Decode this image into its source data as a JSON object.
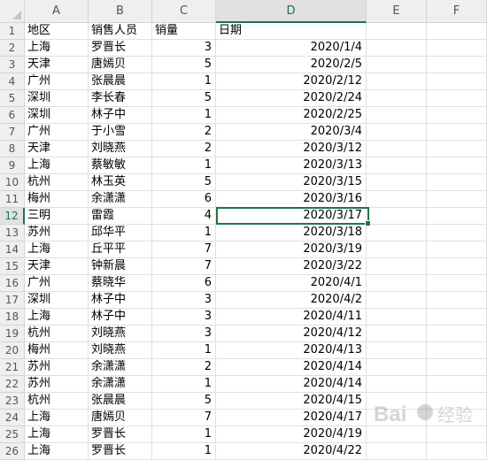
{
  "sheet": {
    "columns": [
      "A",
      "B",
      "C",
      "D",
      "E",
      "F"
    ],
    "selected_column": "D",
    "selected_row": "12",
    "rows": [
      {
        "n": "1",
        "a": "地区",
        "b": "销售人员",
        "c": "销量",
        "d": "日期"
      },
      {
        "n": "2",
        "a": "上海",
        "b": "罗晋长",
        "c": "3",
        "d": "2020/1/4"
      },
      {
        "n": "3",
        "a": "天津",
        "b": "唐嫣贝",
        "c": "5",
        "d": "2020/2/5"
      },
      {
        "n": "4",
        "a": "广州",
        "b": "张晨晨",
        "c": "1",
        "d": "2020/2/12"
      },
      {
        "n": "5",
        "a": "深圳",
        "b": "李长春",
        "c": "5",
        "d": "2020/2/24"
      },
      {
        "n": "6",
        "a": "深圳",
        "b": "林子中",
        "c": "1",
        "d": "2020/2/25"
      },
      {
        "n": "7",
        "a": "广州",
        "b": "于小雪",
        "c": "2",
        "d": "2020/3/4"
      },
      {
        "n": "8",
        "a": "天津",
        "b": "刘晓燕",
        "c": "2",
        "d": "2020/3/12"
      },
      {
        "n": "9",
        "a": "上海",
        "b": "蔡敏敏",
        "c": "1",
        "d": "2020/3/13"
      },
      {
        "n": "10",
        "a": "杭州",
        "b": "林玉英",
        "c": "5",
        "d": "2020/3/15"
      },
      {
        "n": "11",
        "a": "梅州",
        "b": "余潇潇",
        "c": "6",
        "d": "2020/3/16"
      },
      {
        "n": "12",
        "a": "三明",
        "b": "雷霞",
        "c": "4",
        "d": "2020/3/17"
      },
      {
        "n": "13",
        "a": "苏州",
        "b": "邱华平",
        "c": "1",
        "d": "2020/3/18"
      },
      {
        "n": "14",
        "a": "上海",
        "b": "丘平平",
        "c": "7",
        "d": "2020/3/19"
      },
      {
        "n": "15",
        "a": "天津",
        "b": "钟新晨",
        "c": "7",
        "d": "2020/3/22"
      },
      {
        "n": "16",
        "a": "广州",
        "b": "蔡晓华",
        "c": "6",
        "d": "2020/4/1"
      },
      {
        "n": "17",
        "a": "深圳",
        "b": "林子中",
        "c": "3",
        "d": "2020/4/2"
      },
      {
        "n": "18",
        "a": "上海",
        "b": "林子中",
        "c": "3",
        "d": "2020/4/11"
      },
      {
        "n": "19",
        "a": "杭州",
        "b": "刘晓燕",
        "c": "3",
        "d": "2020/4/12"
      },
      {
        "n": "20",
        "a": "梅州",
        "b": "刘晓燕",
        "c": "1",
        "d": "2020/4/13"
      },
      {
        "n": "21",
        "a": "苏州",
        "b": "余潇潇",
        "c": "2",
        "d": "2020/4/14"
      },
      {
        "n": "22",
        "a": "苏州",
        "b": "余潇潇",
        "c": "1",
        "d": "2020/4/14"
      },
      {
        "n": "23",
        "a": "杭州",
        "b": "张晨晨",
        "c": "5",
        "d": "2020/4/15"
      },
      {
        "n": "24",
        "a": "上海",
        "b": "唐嫣贝",
        "c": "7",
        "d": "2020/4/17"
      },
      {
        "n": "25",
        "a": "上海",
        "b": "罗晋长",
        "c": "1",
        "d": "2020/4/19"
      },
      {
        "n": "26",
        "a": "上海",
        "b": "罗晋长",
        "c": "1",
        "d": "2020/4/22"
      }
    ]
  },
  "watermark": {
    "text": "Bai 经验"
  },
  "colors": {
    "accent": "#217346"
  }
}
